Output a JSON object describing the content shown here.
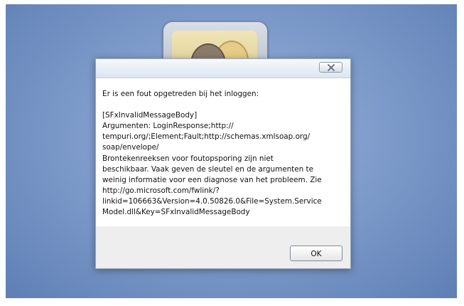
{
  "dialog": {
    "message_lines": [
      "Er is een fout opgetreden bij het inloggen:",
      "",
      "[SFxInvalidMessageBody]",
      "Argumenten: LoginResponse;http://",
      "tempuri.org/;Element;Fault;http://schemas.xmlsoap.org/",
      "soap/envelope/",
      "Brontekenreeksen voor foutopsporing zijn niet",
      "beschikbaar. Vaak geven de sleutel en de argumenten te",
      "weinig informatie voor een diagnose van het probleem. Zie",
      "http://go.microsoft.com/fwlink/?",
      "linkid=106663&Version=4.0.50826.0&File=System.Service",
      "Model.dll&Key=SFxInvalidMessageBody"
    ],
    "ok_label": "OK",
    "close_icon": "close-icon"
  },
  "avatar": {
    "icon": "user-avatar-icon"
  }
}
